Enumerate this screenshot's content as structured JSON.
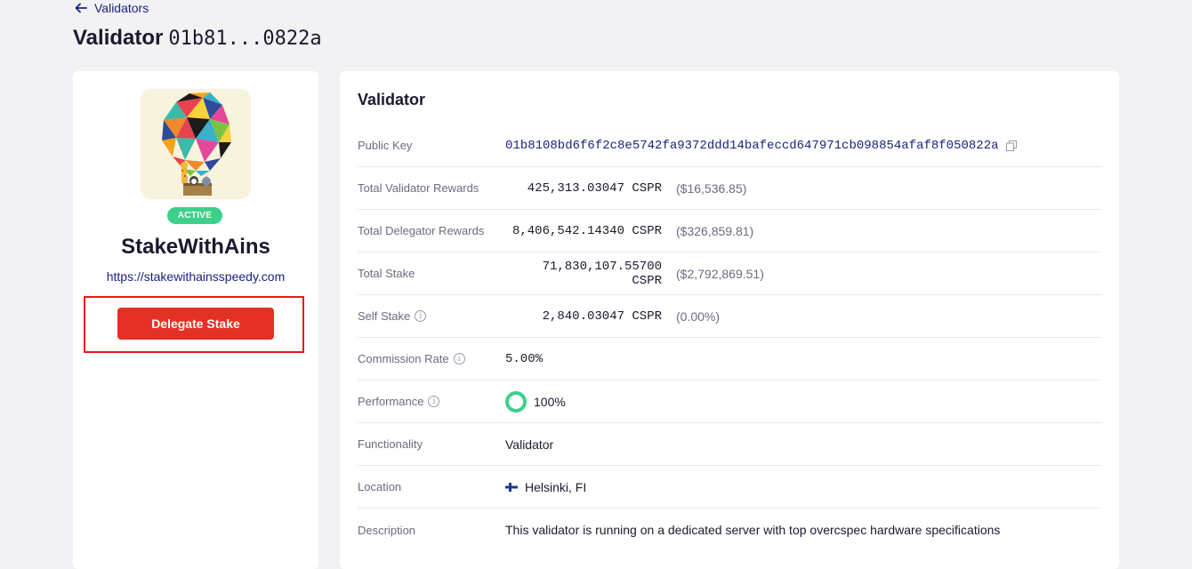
{
  "nav": {
    "back_label": "Validators"
  },
  "header": {
    "title": "Validator",
    "hash": "01b81...0822a"
  },
  "profile": {
    "status": "ACTIVE",
    "name": "StakeWithAins",
    "url": "https://stakewithainsspeedy.com",
    "delegate_label": "Delegate Stake",
    "logo_icon": "hot-air-balloon-logo"
  },
  "details": {
    "title": "Validator",
    "public_key_label": "Public Key",
    "public_key": "01b8108bd6f6f2c8e5742fa9372ddd14bafeccd647971cb098854afaf8f050822a",
    "total_validator_rewards_label": "Total Validator Rewards",
    "total_validator_rewards": "425,313.03047 CSPR",
    "total_validator_rewards_usd": "($16,536.85)",
    "total_delegator_rewards_label": "Total Delegator Rewards",
    "total_delegator_rewards": "8,406,542.14340 CSPR",
    "total_delegator_rewards_usd": "($326,859.81)",
    "total_stake_label": "Total Stake",
    "total_stake": "71,830,107.55700 CSPR",
    "total_stake_usd": "($2,792,869.51)",
    "self_stake_label": "Self Stake",
    "self_stake": "2,840.03047 CSPR",
    "self_stake_pct": "(0.00%)",
    "commission_rate_label": "Commission Rate",
    "commission_rate": "5.00%",
    "performance_label": "Performance",
    "performance": "100%",
    "functionality_label": "Functionality",
    "functionality": "Validator",
    "location_label": "Location",
    "location": "Helsinki, FI",
    "description_label": "Description",
    "description": "This validator is running on a dedicated server with top overcspec hardware specifications"
  },
  "colors": {
    "accent": "#1a237e",
    "active": "#3bd18a",
    "delegate": "#e53125",
    "highlight": "#e31b1b"
  }
}
